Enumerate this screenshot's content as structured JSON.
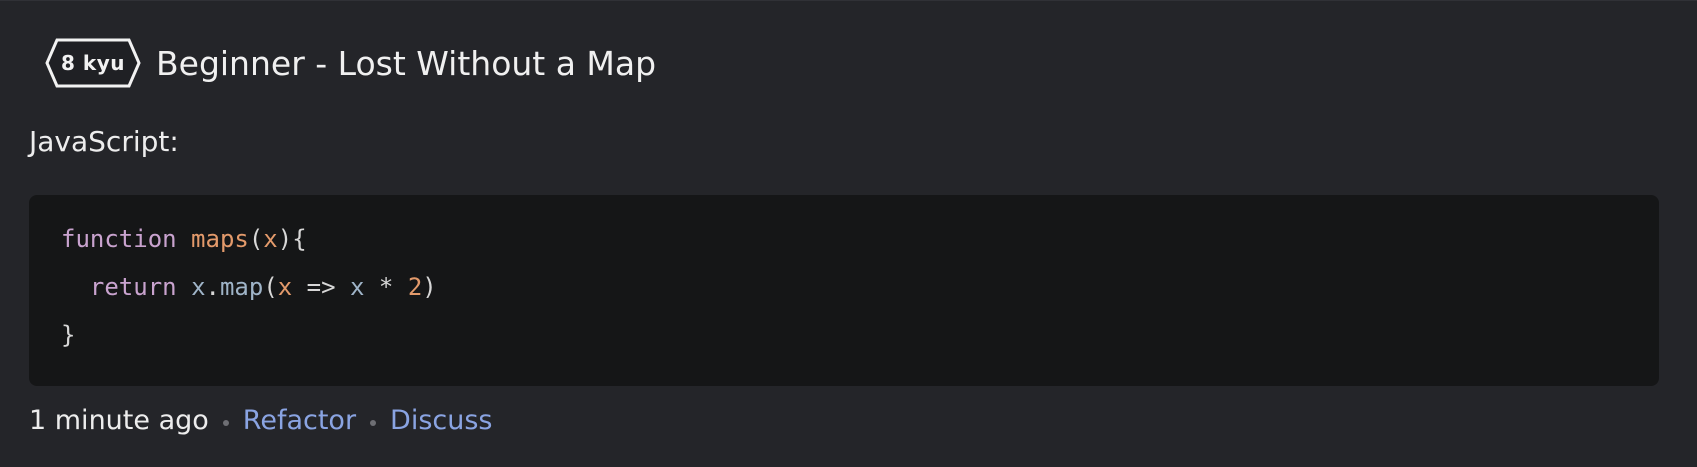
{
  "kata": {
    "rank": "8 kyu",
    "title": "Beginner - Lost Without a Map"
  },
  "solution": {
    "language_label": "JavaScript:",
    "code_lines": [
      [
        {
          "t": "function",
          "c": "kw"
        },
        {
          "t": " ",
          "c": "punc"
        },
        {
          "t": "maps",
          "c": "fn"
        },
        {
          "t": "(",
          "c": "punc"
        },
        {
          "t": "x",
          "c": "param"
        },
        {
          "t": "){",
          "c": "punc"
        }
      ],
      [
        {
          "t": "  ",
          "c": "punc"
        },
        {
          "t": "return",
          "c": "kw"
        },
        {
          "t": " ",
          "c": "punc"
        },
        {
          "t": "x",
          "c": "var"
        },
        {
          "t": ".",
          "c": "punc"
        },
        {
          "t": "map",
          "c": "method"
        },
        {
          "t": "(",
          "c": "punc"
        },
        {
          "t": "x",
          "c": "param"
        },
        {
          "t": " => ",
          "c": "op"
        },
        {
          "t": "x",
          "c": "var"
        },
        {
          "t": " * ",
          "c": "op"
        },
        {
          "t": "2",
          "c": "num"
        },
        {
          "t": ")",
          "c": "punc"
        }
      ],
      [
        {
          "t": "}",
          "c": "punc"
        }
      ]
    ]
  },
  "footer": {
    "timestamp": "1 minute ago",
    "refactor_label": "Refactor",
    "discuss_label": "Discuss"
  },
  "colors": {
    "background": "#242529",
    "code_background": "#151617",
    "link": "#8aa4e2",
    "keyword": "#c9a3cf",
    "function_name": "#e39a6b"
  },
  "icons": {
    "rank_badge": "hexagon-badge-icon"
  }
}
